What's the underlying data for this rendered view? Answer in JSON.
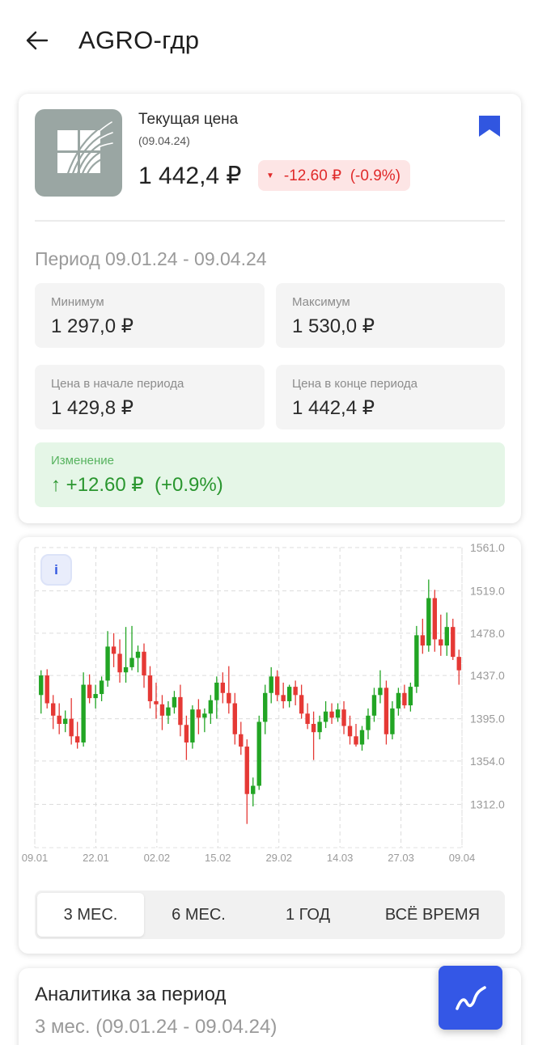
{
  "header": {
    "title": "AGRO-гдр"
  },
  "quote": {
    "current_label": "Текущая цена",
    "date": "(09.04.24)",
    "price": "1 442,4 ₽",
    "change": "-12.60 ₽  (-0.9%)",
    "change_color": "#e02a2a"
  },
  "period": {
    "label": "Период 09.01.24 - 09.04.24",
    "min_label": "Минимум",
    "min_value": "1 297,0 ₽",
    "max_label": "Максимум",
    "max_value": "1 530,0 ₽",
    "start_label": "Цена в начале периода",
    "start_value": "1 429,8 ₽",
    "end_label": "Цена в конце периода",
    "end_value": "1 442,4 ₽",
    "change_label": "Изменение",
    "change_value": "+12.60 ₽  (+0.9%)",
    "change_color": "#2a962f"
  },
  "chart": {
    "info_label": "i",
    "ranges": [
      "3 МЕС.",
      "6 МЕС.",
      "1 ГОД",
      "ВСЁ ВРЕМЯ"
    ],
    "selected_range": "3 МЕС."
  },
  "chart_data": {
    "type": "candlestick",
    "y_ticks": [
      "1561.0",
      "1519.0",
      "1478.0",
      "1437.0",
      "1395.0",
      "1354.0",
      "1312.0"
    ],
    "x_ticks": [
      "09.01",
      "22.01",
      "02.02",
      "15.02",
      "29.02",
      "14.03",
      "27.03",
      "09.04"
    ],
    "ylim": [
      1270.0,
      1561.0
    ],
    "up_color": "#22a524",
    "down_color": "#e53935",
    "grid": true,
    "candles": [
      {
        "o": 1418,
        "h": 1442,
        "l": 1400,
        "c": 1437
      },
      {
        "o": 1437,
        "h": 1443,
        "l": 1405,
        "c": 1410
      },
      {
        "o": 1410,
        "h": 1418,
        "l": 1385,
        "c": 1398
      },
      {
        "o": 1398,
        "h": 1410,
        "l": 1380,
        "c": 1390
      },
      {
        "o": 1390,
        "h": 1403,
        "l": 1382,
        "c": 1395
      },
      {
        "o": 1395,
        "h": 1415,
        "l": 1370,
        "c": 1378
      },
      {
        "o": 1378,
        "h": 1392,
        "l": 1366,
        "c": 1372
      },
      {
        "o": 1372,
        "h": 1440,
        "l": 1368,
        "c": 1428
      },
      {
        "o": 1428,
        "h": 1438,
        "l": 1410,
        "c": 1415
      },
      {
        "o": 1415,
        "h": 1428,
        "l": 1405,
        "c": 1419
      },
      {
        "o": 1419,
        "h": 1436,
        "l": 1412,
        "c": 1432
      },
      {
        "o": 1432,
        "h": 1480,
        "l": 1426,
        "c": 1465
      },
      {
        "o": 1465,
        "h": 1478,
        "l": 1445,
        "c": 1458
      },
      {
        "o": 1458,
        "h": 1472,
        "l": 1430,
        "c": 1440
      },
      {
        "o": 1440,
        "h": 1484,
        "l": 1430,
        "c": 1445
      },
      {
        "o": 1445,
        "h": 1485,
        "l": 1442,
        "c": 1454
      },
      {
        "o": 1454,
        "h": 1466,
        "l": 1440,
        "c": 1460
      },
      {
        "o": 1460,
        "h": 1468,
        "l": 1425,
        "c": 1437
      },
      {
        "o": 1437,
        "h": 1446,
        "l": 1405,
        "c": 1412
      },
      {
        "o": 1412,
        "h": 1430,
        "l": 1395,
        "c": 1409
      },
      {
        "o": 1409,
        "h": 1418,
        "l": 1384,
        "c": 1398
      },
      {
        "o": 1398,
        "h": 1412,
        "l": 1390,
        "c": 1406
      },
      {
        "o": 1406,
        "h": 1422,
        "l": 1400,
        "c": 1416
      },
      {
        "o": 1416,
        "h": 1428,
        "l": 1378,
        "c": 1389
      },
      {
        "o": 1389,
        "h": 1398,
        "l": 1355,
        "c": 1372
      },
      {
        "o": 1372,
        "h": 1408,
        "l": 1366,
        "c": 1404
      },
      {
        "o": 1404,
        "h": 1414,
        "l": 1380,
        "c": 1396
      },
      {
        "o": 1396,
        "h": 1405,
        "l": 1382,
        "c": 1400
      },
      {
        "o": 1400,
        "h": 1418,
        "l": 1390,
        "c": 1413
      },
      {
        "o": 1413,
        "h": 1436,
        "l": 1395,
        "c": 1430
      },
      {
        "o": 1430,
        "h": 1440,
        "l": 1410,
        "c": 1420
      },
      {
        "o": 1420,
        "h": 1446,
        "l": 1400,
        "c": 1410
      },
      {
        "o": 1410,
        "h": 1420,
        "l": 1370,
        "c": 1380
      },
      {
        "o": 1380,
        "h": 1392,
        "l": 1360,
        "c": 1368
      },
      {
        "o": 1368,
        "h": 1375,
        "l": 1293,
        "c": 1322
      },
      {
        "o": 1322,
        "h": 1338,
        "l": 1310,
        "c": 1330
      },
      {
        "o": 1330,
        "h": 1398,
        "l": 1326,
        "c": 1392
      },
      {
        "o": 1392,
        "h": 1428,
        "l": 1380,
        "c": 1420
      },
      {
        "o": 1420,
        "h": 1445,
        "l": 1410,
        "c": 1436
      },
      {
        "o": 1436,
        "h": 1442,
        "l": 1412,
        "c": 1418
      },
      {
        "o": 1418,
        "h": 1430,
        "l": 1405,
        "c": 1412
      },
      {
        "o": 1412,
        "h": 1428,
        "l": 1406,
        "c": 1426
      },
      {
        "o": 1426,
        "h": 1432,
        "l": 1408,
        "c": 1418
      },
      {
        "o": 1418,
        "h": 1428,
        "l": 1395,
        "c": 1400
      },
      {
        "o": 1400,
        "h": 1410,
        "l": 1385,
        "c": 1390
      },
      {
        "o": 1390,
        "h": 1402,
        "l": 1355,
        "c": 1382
      },
      {
        "o": 1382,
        "h": 1398,
        "l": 1375,
        "c": 1392
      },
      {
        "o": 1392,
        "h": 1412,
        "l": 1386,
        "c": 1402
      },
      {
        "o": 1402,
        "h": 1410,
        "l": 1390,
        "c": 1396
      },
      {
        "o": 1396,
        "h": 1410,
        "l": 1392,
        "c": 1404
      },
      {
        "o": 1404,
        "h": 1412,
        "l": 1380,
        "c": 1388
      },
      {
        "o": 1388,
        "h": 1398,
        "l": 1370,
        "c": 1378
      },
      {
        "o": 1378,
        "h": 1390,
        "l": 1368,
        "c": 1370
      },
      {
        "o": 1370,
        "h": 1388,
        "l": 1364,
        "c": 1384
      },
      {
        "o": 1384,
        "h": 1405,
        "l": 1375,
        "c": 1398
      },
      {
        "o": 1398,
        "h": 1425,
        "l": 1392,
        "c": 1418
      },
      {
        "o": 1418,
        "h": 1442,
        "l": 1410,
        "c": 1425
      },
      {
        "o": 1425,
        "h": 1432,
        "l": 1370,
        "c": 1380
      },
      {
        "o": 1380,
        "h": 1412,
        "l": 1375,
        "c": 1405
      },
      {
        "o": 1405,
        "h": 1425,
        "l": 1398,
        "c": 1420
      },
      {
        "o": 1420,
        "h": 1428,
        "l": 1405,
        "c": 1408
      },
      {
        "o": 1408,
        "h": 1430,
        "l": 1402,
        "c": 1426
      },
      {
        "o": 1426,
        "h": 1485,
        "l": 1420,
        "c": 1476
      },
      {
        "o": 1476,
        "h": 1492,
        "l": 1458,
        "c": 1466
      },
      {
        "o": 1466,
        "h": 1530,
        "l": 1460,
        "c": 1512
      },
      {
        "o": 1512,
        "h": 1520,
        "l": 1460,
        "c": 1472
      },
      {
        "o": 1472,
        "h": 1496,
        "l": 1456,
        "c": 1466
      },
      {
        "o": 1466,
        "h": 1498,
        "l": 1456,
        "c": 1484
      },
      {
        "o": 1484,
        "h": 1492,
        "l": 1452,
        "c": 1455
      },
      {
        "o": 1455,
        "h": 1462,
        "l": 1428,
        "c": 1442
      }
    ]
  },
  "analytics": {
    "title": "Аналитика за период",
    "subtitle": "3 мес. (09.01.24 - 09.04.24)"
  }
}
